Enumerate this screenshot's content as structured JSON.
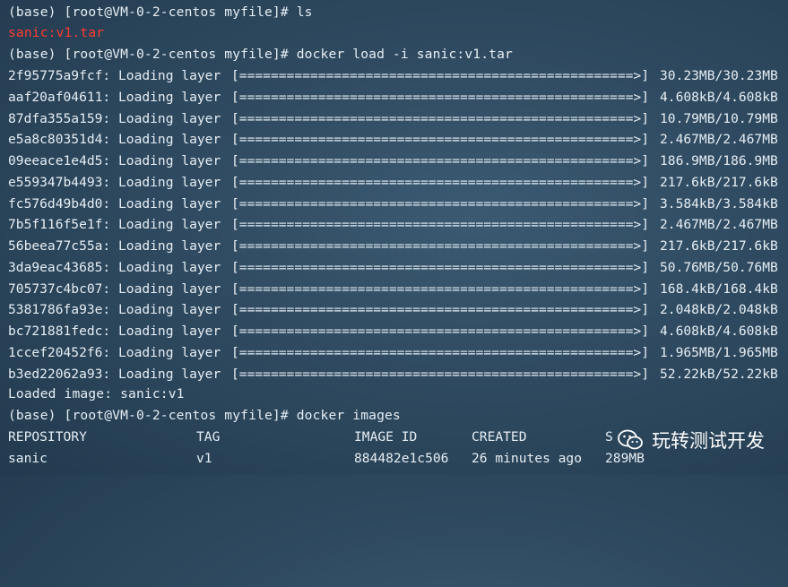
{
  "terminal": {
    "prompt_ls": "(base) [root@VM-0-2-centos myfile]# ls",
    "ls_output": "sanic:v1.tar",
    "prompt_load": "(base) [root@VM-0-2-centos myfile]# docker load -i sanic:v1.tar",
    "bar": "[==================================================>]",
    "layers": [
      {
        "id": "2f95775a9fcf: Loading layer",
        "progress": "30.23MB/30.23MB"
      },
      {
        "id": "aaf20af04611: Loading layer",
        "progress": "4.608kB/4.608kB"
      },
      {
        "id": "87dfa355a159: Loading layer",
        "progress": "10.79MB/10.79MB"
      },
      {
        "id": "e5a8c80351d4: Loading layer",
        "progress": "2.467MB/2.467MB"
      },
      {
        "id": "09eeace1e4d5: Loading layer",
        "progress": "186.9MB/186.9MB"
      },
      {
        "id": "e559347b4493: Loading layer",
        "progress": "217.6kB/217.6kB"
      },
      {
        "id": "fc576d49b4d0: Loading layer",
        "progress": "3.584kB/3.584kB"
      },
      {
        "id": "7b5f116f5e1f: Loading layer",
        "progress": "2.467MB/2.467MB"
      },
      {
        "id": "56beea77c55a: Loading layer",
        "progress": "217.6kB/217.6kB"
      },
      {
        "id": "3da9eac43685: Loading layer",
        "progress": "50.76MB/50.76MB"
      },
      {
        "id": "705737c4bc07: Loading layer",
        "progress": "168.4kB/168.4kB"
      },
      {
        "id": "5381786fa93e: Loading layer",
        "progress": "2.048kB/2.048kB"
      },
      {
        "id": "bc721881fedc: Loading layer",
        "progress": "4.608kB/4.608kB"
      },
      {
        "id": "1ccef20452f6: Loading layer",
        "progress": "1.965MB/1.965MB"
      },
      {
        "id": "b3ed22062a93: Loading layer",
        "progress": "52.22kB/52.22kB"
      }
    ],
    "loaded": "Loaded image: sanic:v1",
    "prompt_images": "(base) [root@VM-0-2-centos myfile]# docker images",
    "images_header": {
      "repository": "REPOSITORY",
      "tag": "TAG",
      "image_id": "IMAGE ID",
      "created": "CREATED",
      "size": "S"
    },
    "images_rows": [
      {
        "repository": "sanic",
        "tag": "v1",
        "image_id": "884482e1c506",
        "created": "26 minutes ago",
        "size": "289MB"
      }
    ]
  },
  "watermark": {
    "text": "玩转测试开发",
    "icon": "wechat-icon"
  }
}
